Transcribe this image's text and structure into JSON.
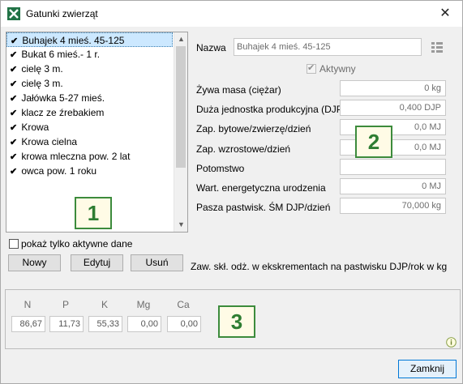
{
  "window": {
    "title": "Gatunki zwierząt",
    "close_glyph": "✕"
  },
  "list": {
    "items": [
      "Buhajek 4 mieś. 45-125",
      "Bukat 6 mieś.- 1 r.",
      "cielę 3 m.",
      "cielę 3 m.",
      "Jałówka 5-27 mieś.",
      "klacz ze źrebakiem",
      "Krowa",
      "Krowa cielna",
      "krowa mleczna pow. 2 lat",
      "owca pow. 1 roku"
    ],
    "selected_index": 0,
    "check_glyph": "✔",
    "scroll_up": "▲",
    "scroll_down": "▼"
  },
  "badges": {
    "b1": "1",
    "b2": "2",
    "b3": "3"
  },
  "active_only_label": "pokaż tylko aktywne dane",
  "buttons": {
    "new": "Nowy",
    "edit": "Edytuj",
    "delete": "Usuń",
    "close": "Zamknij"
  },
  "details": {
    "name_label": "Nazwa",
    "name_value": "Buhajek 4 mieś. 45-125",
    "active_label": "Aktywny",
    "rows": [
      {
        "label": "Żywa masa (ciężar)",
        "value": "0 kg"
      },
      {
        "label": "Duża jednostka produkcyjna (DJP)",
        "value": "0,400 DJP"
      },
      {
        "label": "Zap. bytowe/zwierzę/dzień",
        "value": "0,0 MJ"
      },
      {
        "label": "Zap. wzrostowe/dzień",
        "value": "0,0 MJ"
      },
      {
        "label": "Potomstwo",
        "value": ""
      },
      {
        "label": "Wart. energetyczna urodzenia",
        "value": "0 MJ"
      },
      {
        "label": "Pasza pastwisk. ŚM DJP/dzień",
        "value": "70,000 kg"
      }
    ],
    "note": "Zaw. skł. odż. w ekskrementach na pastwisku DJP/rok w kg"
  },
  "nutrients": {
    "headers": [
      "N",
      "P",
      "K",
      "Mg",
      "Ca"
    ],
    "values": [
      "86,67",
      "11,73",
      "55,33",
      "0,00",
      "0,00"
    ]
  },
  "colors": {
    "accent": "#0078d7",
    "selection": "#cce8ff",
    "badge_border": "#3c8b3c",
    "badge_text": "#2e7d32",
    "app_icon": "#217346"
  }
}
